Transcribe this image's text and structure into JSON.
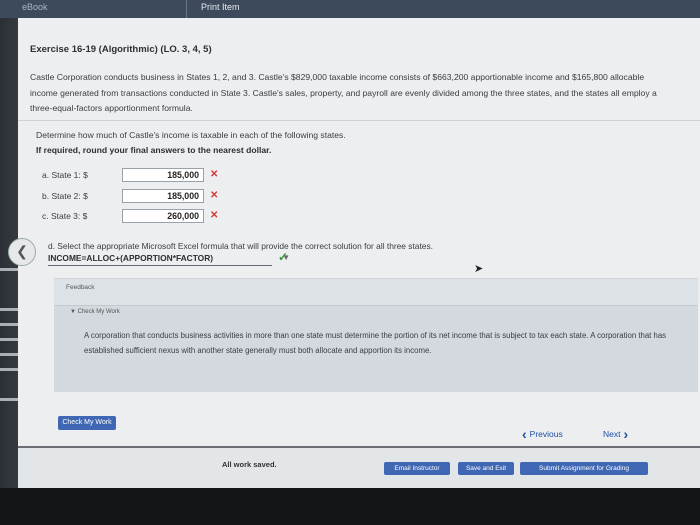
{
  "topbar": {
    "ebook": "eBook",
    "print_item": "Print Item"
  },
  "exercise": {
    "title": "Exercise 16-19 (Algorithmic) (LO. 3, 4, 5)",
    "paragraph": "Castle Corporation conducts business in States 1, 2, and 3. Castle's $829,000 taxable income consists of $663,200 apportionable income and $165,800 allocable income generated from transactions conducted in State 3. Castle's sales, property, and payroll are evenly divided among the three states, and the states all employ a three-equal-factors apportionment formula.",
    "instruction": "Determine how much of Castle's income is taxable in each of the following states.",
    "rounding": "If required, round your final answers to the nearest dollar."
  },
  "answers": [
    {
      "label": "a. State 1: $",
      "value": "185,000",
      "mark": "✕"
    },
    {
      "label": "b. State 2: $",
      "value": "185,000",
      "mark": "✕"
    },
    {
      "label": "c. State 3: $",
      "value": "260,000",
      "mark": "✕"
    }
  ],
  "part_d": {
    "prompt": "d. Select the appropriate Microsoft Excel formula that will provide the correct solution for all three states.",
    "selected": "INCOME=ALLOC+(APPORTION*FACTOR)",
    "mark": "✓"
  },
  "feedback": {
    "label": "Feedback",
    "check_my_work": "▼ Check My Work",
    "text": "A corporation that conducts business activities in more than one state must determine the portion of its net income that is subject to tax each state. A corporation that has established sufficient nexus with another state generally must both allocate and apportion its income."
  },
  "buttons": {
    "check_my_work": "Check My Work",
    "previous": "Previous",
    "next": "Next",
    "email_instructor": "Email Instructor",
    "save_and_exit": "Save and Exit",
    "submit": "Submit Assignment for Grading"
  },
  "status": {
    "saved": "All work saved."
  },
  "colors": {
    "accent": "#3f67b4",
    "error": "#d23a3a",
    "success": "#3a9a3a"
  }
}
